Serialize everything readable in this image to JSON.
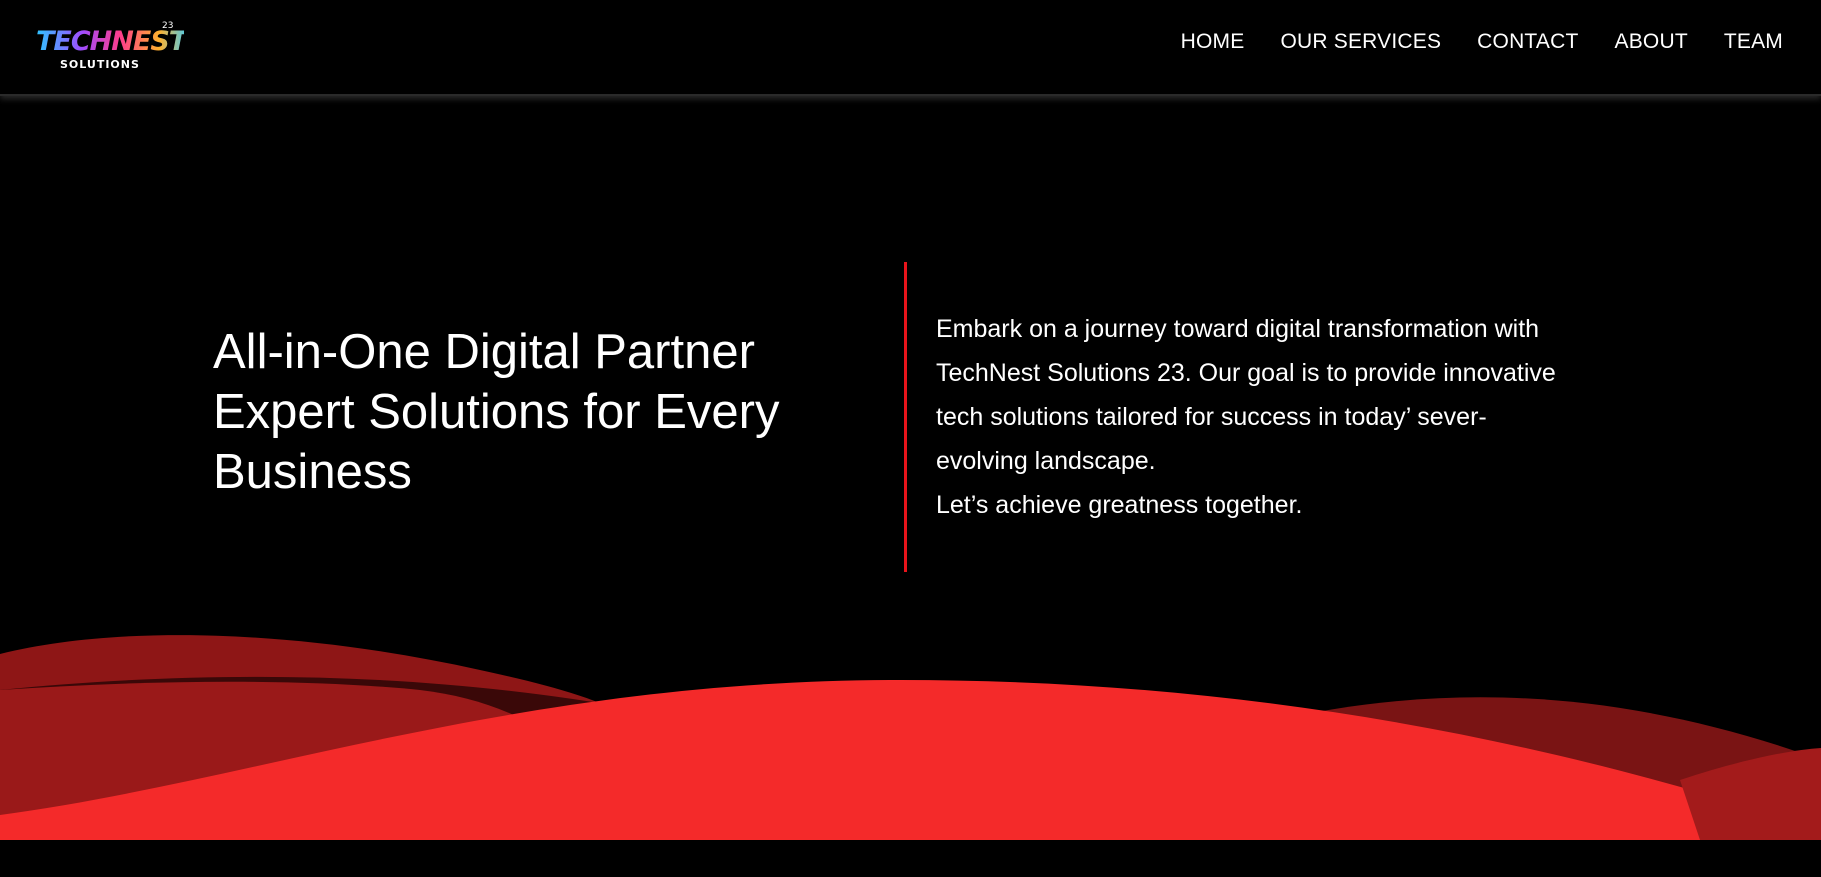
{
  "brand": {
    "logo_text": "TECHNEST",
    "logo_sub": "SOLUTIONS",
    "logo_badge": "23"
  },
  "nav": {
    "items": [
      {
        "label": "HOME"
      },
      {
        "label": "OUR SERVICES"
      },
      {
        "label": "CONTACT"
      },
      {
        "label": "ABOUT"
      },
      {
        "label": "TEAM"
      }
    ]
  },
  "hero": {
    "title_lines": [
      "All-in-One Digital Partner",
      "Expert Solutions for Every",
      "Business"
    ],
    "description_lines": [
      "Embark on a journey toward digital transformation with",
      "TechNest Solutions 23. Our goal is to provide innovative",
      "tech solutions tailored for success in today’ sever-",
      "evolving landscape.",
      "Let’s achieve greatness together."
    ]
  },
  "colors": {
    "background": "#000000",
    "accent_red": "#f42a2a",
    "wave_dark": "#8a1515",
    "wave_mid": "#a31b1b",
    "divider": "#e8141b"
  }
}
